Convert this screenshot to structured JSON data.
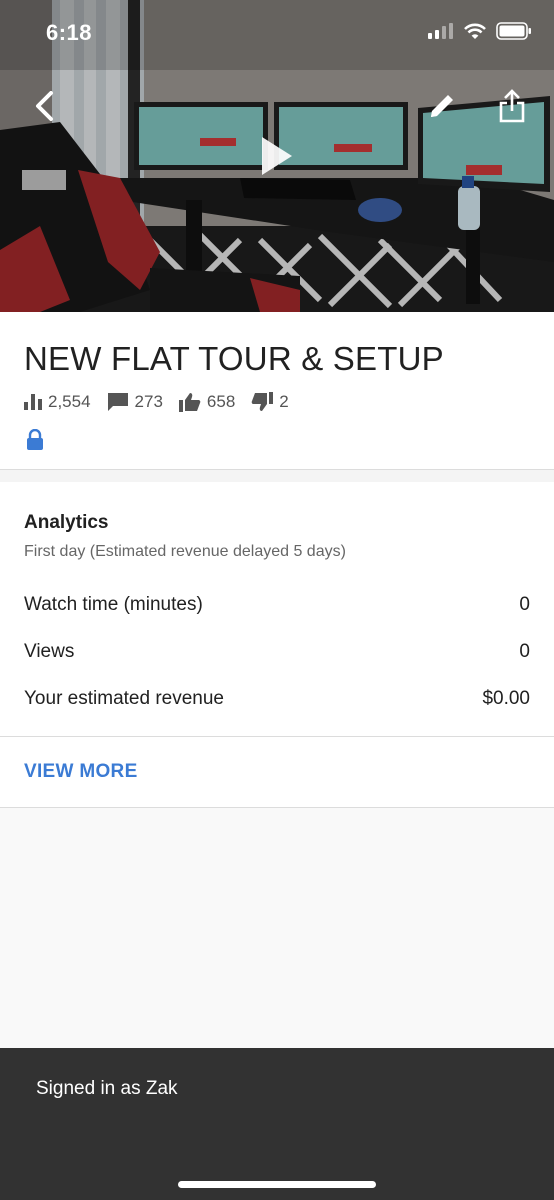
{
  "status_bar": {
    "time": "6:18"
  },
  "video": {
    "title": "NEW FLAT TOUR & SETUP",
    "stats": {
      "views": "2,554",
      "comments": "273",
      "likes": "658",
      "dislikes": "2"
    },
    "privacy_icon": "lock-icon"
  },
  "analytics": {
    "heading": "Analytics",
    "subtitle": "First day (Estimated revenue delayed 5 days)",
    "rows": [
      {
        "label": "Watch time (minutes)",
        "value": "0"
      },
      {
        "label": "Views",
        "value": "0"
      },
      {
        "label": "Your estimated revenue",
        "value": "$0.00"
      }
    ],
    "view_more_label": "VIEW MORE"
  },
  "snackbar": {
    "text": "Signed in as Zak"
  },
  "colors": {
    "accent": "#3b7bd4",
    "snackbar_bg": "#323232",
    "divider": "#dcdcdc"
  }
}
